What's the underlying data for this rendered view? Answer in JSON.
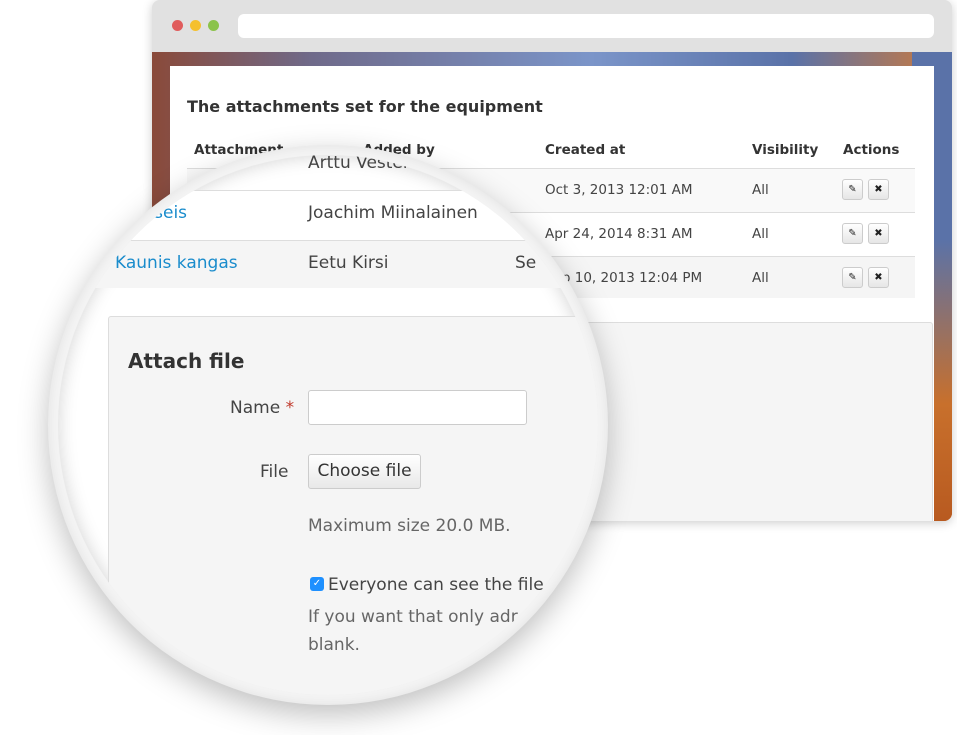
{
  "window": {
    "dot_colors": [
      "#e05c5c",
      "#f5c02e",
      "#8bc34a"
    ]
  },
  "section_title": "The attachments set for the equipment",
  "table": {
    "headers": [
      "Attachment",
      "Added by",
      "Created at",
      "Visibility",
      "Actions"
    ],
    "rows": [
      {
        "attachment": "",
        "added_by": "Arttu Vesterinen",
        "created_at": "Oct 3, 2013 12:01 AM",
        "visibility": "All"
      },
      {
        "attachment": "-seis",
        "added_by": "Joachim Miinalainen",
        "created_at": "Apr 24, 2014 8:31 AM",
        "visibility": "All"
      },
      {
        "attachment": "Kaunis kangas",
        "added_by": "Eetu Kirsi",
        "created_at": "Sep 10, 2013 12:04 PM",
        "visibility": "All"
      }
    ],
    "edit_icon": "pencil-icon",
    "delete_icon": "close-icon",
    "partial_created_in_lens": "Se"
  },
  "attach_form": {
    "title": "Attach file",
    "name_label": "Name",
    "required_mark": "*",
    "name_value": "",
    "file_label": "File",
    "choose_file_label": "Choose file",
    "max_size_text": "Maximum size 20.0 MB.",
    "checkbox_checked": true,
    "checkbox_label": "Everyone can see the file",
    "help_text_line1": "If you want that only adr",
    "help_text_line2": "blank."
  },
  "colors": {
    "link": "#1a8ccc",
    "checkbox": "#1e90ff",
    "required": "#c0392b"
  }
}
